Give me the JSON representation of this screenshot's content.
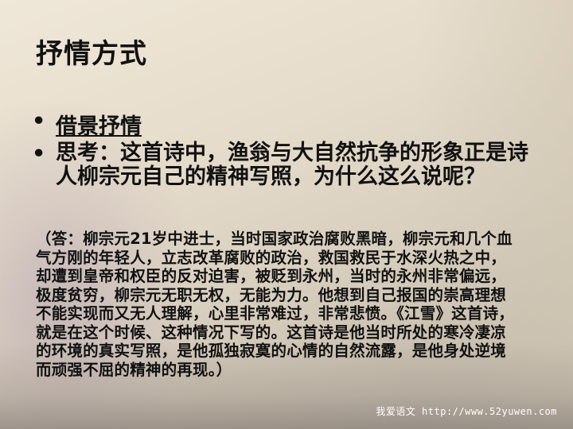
{
  "slide": {
    "title": "抒情方式",
    "bullets": [
      {
        "marker": "•",
        "text": "借景抒情"
      },
      {
        "marker": "•",
        "text": "思考：这首诗中，渔翁与大自然抗争的形象正是诗人柳宗元自己的精神写照，为什么这么说呢？"
      }
    ],
    "answer": "（答：柳宗元21岁中进士，当时国家政治腐败黑暗，柳宗元和几个血气方刚的年轻人，立志改革腐败的政治，救国救民于水深火热之中，却遭到皇帝和权臣的反对迫害，被贬到永州，当时的永州非常偏远，极度贫穷，柳宗元无职无权，无能为力。他想到自己报国的崇高理想不能实现而又无人理解，心里非常难过，非常悲愤。《江雪》这首诗，就是在这个时候、这种情况下写的。这首诗是他当时所处的寒冷凄凉的环境的真实写照，是他孤独寂寞的心情的自然流露，是他身处逆境而顽强不屈的精神的再现。）",
    "watermark": "我爱语文 http://www.52yuwen.com"
  }
}
